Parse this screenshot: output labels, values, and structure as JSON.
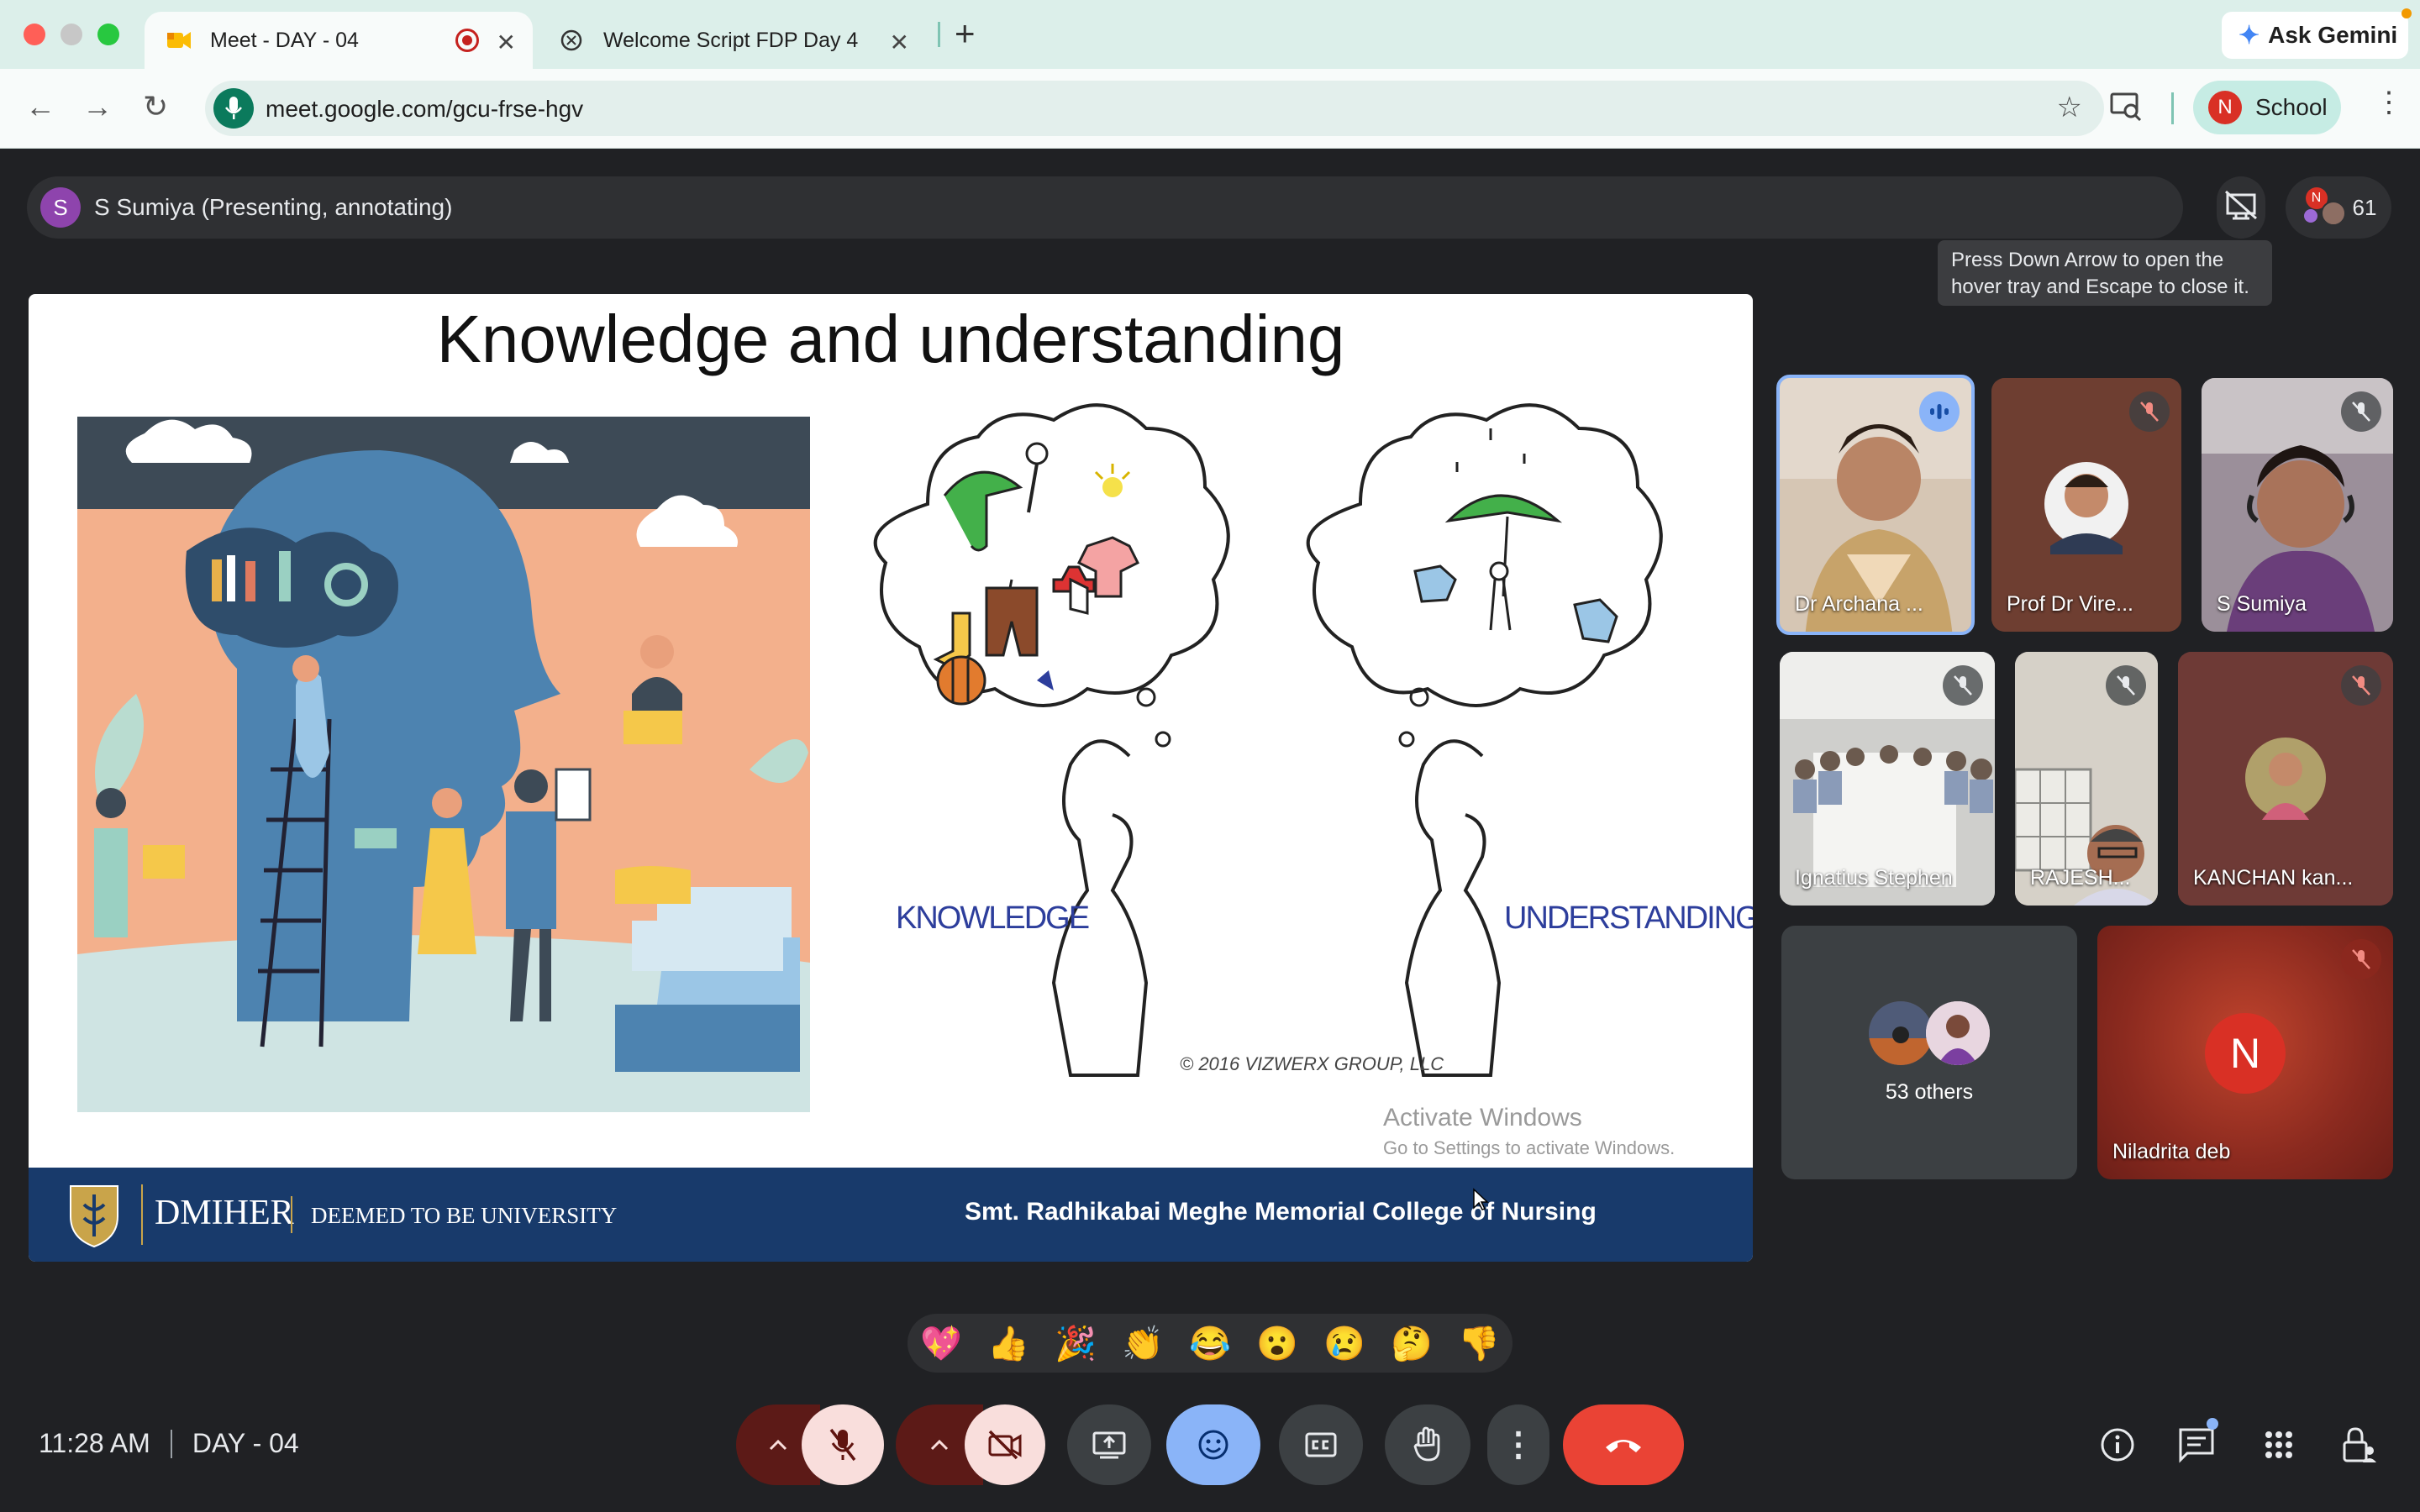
{
  "browser": {
    "tabs": [
      {
        "title": "Meet - DAY - 04",
        "icon": "meet-icon",
        "active": true,
        "recording": true
      },
      {
        "title": "Welcome Script FDP Day 4",
        "icon": "chatgpt-icon",
        "active": false
      }
    ],
    "new_tab_glyph": "+",
    "url": "meet.google.com/gcu-frse-hgv",
    "profile": {
      "initial": "N",
      "label": "School"
    },
    "gemini_label": "Ask Gemini"
  },
  "meet": {
    "presenter": {
      "initial": "S",
      "label": "S Sumiya (Presenting, annotating)"
    },
    "participant_count": "61",
    "participant_initial": "N",
    "tooltip": "Press Down Arrow to open the hover tray and Escape to close it.",
    "slide": {
      "title": "Knowledge and understanding",
      "left_caption": "KNOWLEDGE",
      "right_caption": "UNDERSTANDING",
      "copyright": "© 2016 VIZWERX GROUP, LLC",
      "watermark_title": "Activate Windows",
      "watermark_sub": "Go to Settings to activate Windows.",
      "footer_brand": "DMIHER",
      "footer_tag": "DEEMED TO BE UNIVERSITY",
      "footer_college": "Smt. Radhikabai Meghe Memorial College of Nursing"
    },
    "participants": [
      {
        "name": "Dr Archana ...",
        "muted": false,
        "speaking": true
      },
      {
        "name": "Prof Dr Vire...",
        "muted": true
      },
      {
        "name": "S Sumiya",
        "muted": true
      },
      {
        "name": "Ignatius Stephen",
        "muted": true
      },
      {
        "name": "RAJESH...",
        "muted": true
      },
      {
        "name": "KANCHAN kan...",
        "muted": true
      },
      {
        "name": "53 others"
      },
      {
        "name": "Niladrita deb",
        "initial": "N",
        "muted": true
      }
    ],
    "reactions": [
      "💖",
      "👍",
      "🎉",
      "👏",
      "😂",
      "😮",
      "😢",
      "🤔",
      "👎"
    ],
    "time": "11:28 AM",
    "meeting_name": "DAY - 04",
    "colors": {
      "accent": "#8ab4f8",
      "danger": "#ea4335",
      "muted_btn": "#f9dedc",
      "tile_bg": "#3c4043"
    }
  }
}
